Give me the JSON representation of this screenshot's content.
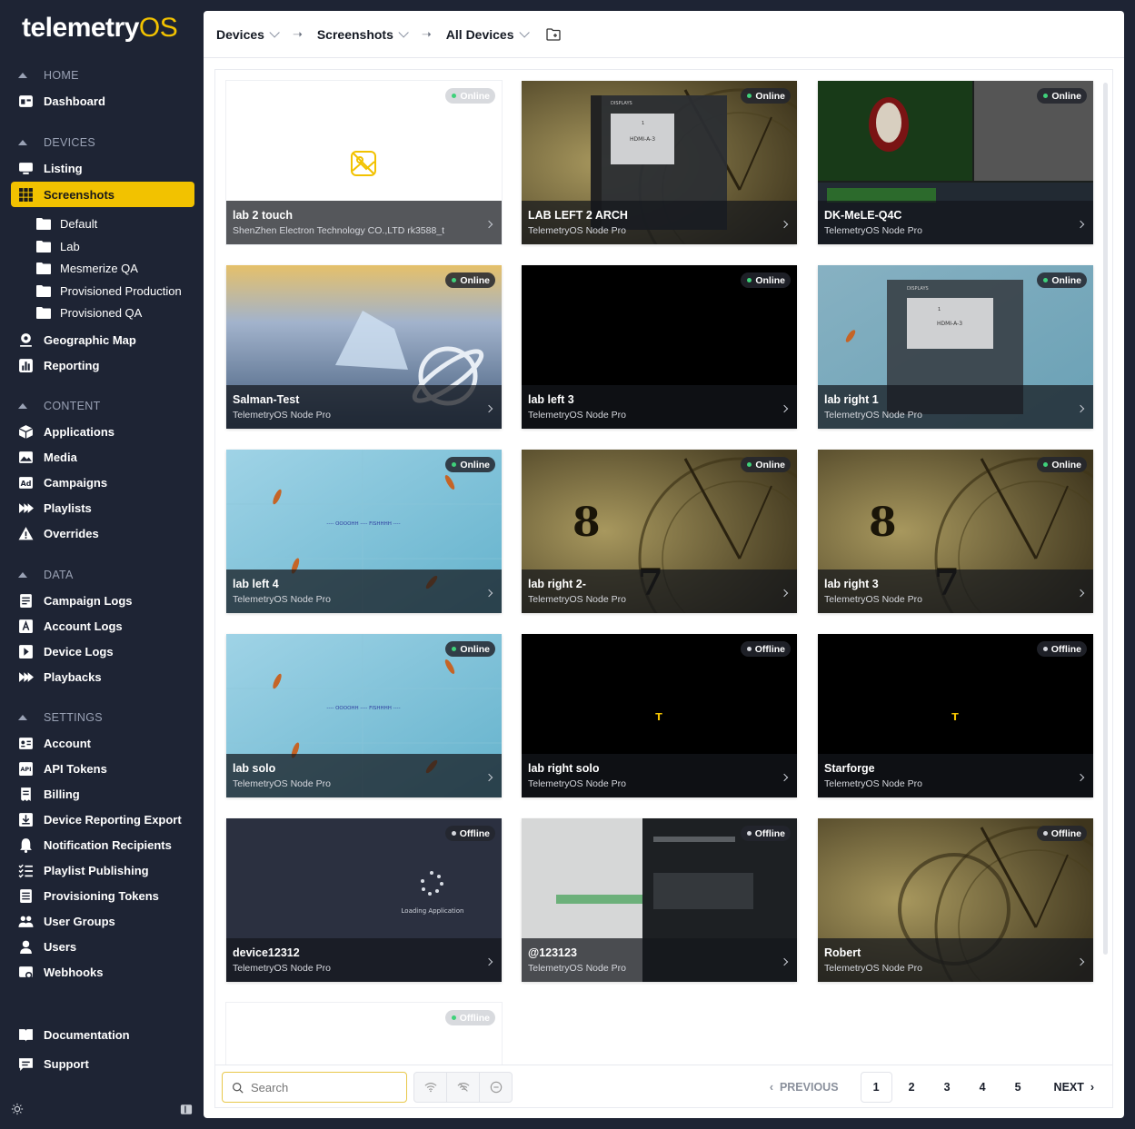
{
  "app": {
    "logo_main": "telemetry",
    "logo_accent": "OS"
  },
  "sidebar": {
    "sections": {
      "home": "HOME",
      "devices": "DEVICES",
      "content": "CONTENT",
      "data": "DATA",
      "settings": "SETTINGS"
    },
    "items": {
      "dashboard": "Dashboard",
      "listing": "Listing",
      "screenshots": "Screenshots",
      "geographic_map": "Geographic Map",
      "reporting": "Reporting",
      "applications": "Applications",
      "media": "Media",
      "campaigns": "Campaigns",
      "playlists": "Playlists",
      "overrides": "Overrides",
      "campaign_logs": "Campaign Logs",
      "account_logs": "Account Logs",
      "device_logs": "Device Logs",
      "playbacks": "Playbacks",
      "account": "Account",
      "api_tokens": "API Tokens",
      "billing": "Billing",
      "device_reporting_export": "Device Reporting Export",
      "notification_recipients": "Notification Recipients",
      "playlist_publishing": "Playlist Publishing",
      "provisioning_tokens": "Provisioning Tokens",
      "user_groups": "User Groups",
      "users": "Users",
      "webhooks": "Webhooks",
      "documentation": "Documentation",
      "support": "Support"
    },
    "folders": [
      "Default",
      "Lab",
      "Mesmerize QA",
      "Provisioned Production",
      "Provisioned QA"
    ]
  },
  "breadcrumb": {
    "devices": "Devices",
    "screenshots": "Screenshots",
    "all_devices": "All Devices"
  },
  "cards": [
    {
      "name": "lab 2 touch",
      "model": "ShenZhen Electron Technology CO.,LTD rk3588_t",
      "status": "Online",
      "thumb": "blank"
    },
    {
      "name": "LAB LEFT 2 ARCH",
      "model": "TelemetryOS Node Pro",
      "status": "Online",
      "thumb": "clock-displays"
    },
    {
      "name": "DK-MeLE-Q4C",
      "model": "TelemetryOS Node Pro",
      "status": "Online",
      "thumb": "dashboard"
    },
    {
      "name": "Salman-Test",
      "model": "TelemetryOS Node Pro",
      "status": "Online",
      "thumb": "ice"
    },
    {
      "name": "lab left 3",
      "model": "TelemetryOS Node Pro",
      "status": "Online",
      "thumb": "black"
    },
    {
      "name": "lab right 1",
      "model": "TelemetryOS Node Pro",
      "status": "Online",
      "thumb": "displays-water"
    },
    {
      "name": "lab left 4",
      "model": "TelemetryOS Node Pro",
      "status": "Online",
      "thumb": "fish"
    },
    {
      "name": "lab right 2-",
      "model": "TelemetryOS Node Pro",
      "status": "Online",
      "thumb": "clock"
    },
    {
      "name": "lab right 3",
      "model": "TelemetryOS Node Pro",
      "status": "Online",
      "thumb": "clock"
    },
    {
      "name": "lab solo",
      "model": "TelemetryOS Node Pro",
      "status": "Online",
      "thumb": "fish"
    },
    {
      "name": "lab right solo",
      "model": "TelemetryOS Node Pro",
      "status": "Offline",
      "thumb": "black-logo"
    },
    {
      "name": "Starforge",
      "model": "TelemetryOS Node Pro",
      "status": "Offline",
      "thumb": "black-logo"
    },
    {
      "name": "device12312",
      "model": "TelemetryOS Node Pro",
      "status": "Offline",
      "thumb": "loading"
    },
    {
      "name": "@123123",
      "model": "TelemetryOS Node Pro",
      "status": "Offline",
      "thumb": "blur-ui"
    },
    {
      "name": "Robert",
      "model": "TelemetryOS Node Pro",
      "status": "Offline",
      "thumb": "clock-zoom"
    },
    {
      "name": "",
      "model": "",
      "status": "Offline",
      "thumb": "blank"
    }
  ],
  "fish_text": {
    "line": "---- OOOOHH ---- FISHHHH ----"
  },
  "loading_text": "Loading Application",
  "displays_panel": {
    "title": "DISPLAYS",
    "screen_label": "HDMI-A-3",
    "index": "1"
  },
  "search": {
    "placeholder": "Search"
  },
  "pagination": {
    "prev": "PREVIOUS",
    "next": "NEXT",
    "pages": [
      "1",
      "2",
      "3",
      "4",
      "5"
    ],
    "current": "1"
  },
  "colors": {
    "accent": "#f2c200",
    "sidebar_bg": "#1e2434",
    "online": "#3fd17a"
  }
}
